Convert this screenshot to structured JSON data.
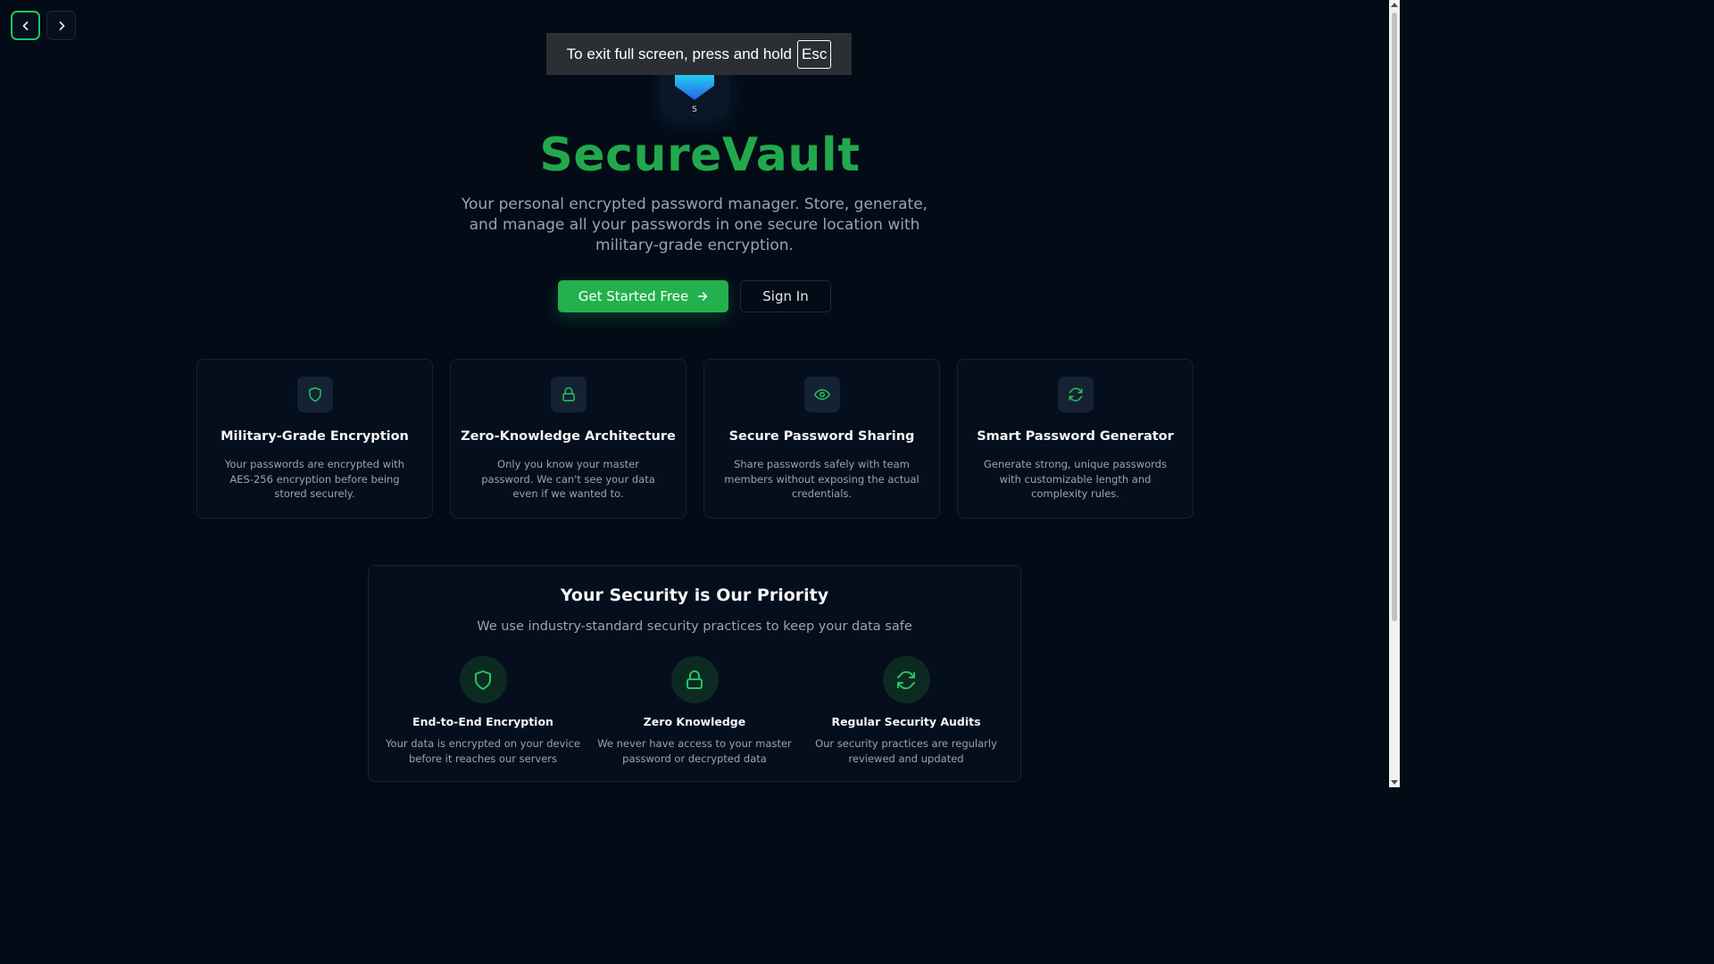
{
  "fullscreen_toast": {
    "message": "To exit full screen, press and hold",
    "key": "Esc"
  },
  "logo": {
    "letter": "S"
  },
  "hero": {
    "title": "SecureVault",
    "subtitle": "Your personal encrypted password manager. Store, generate, and manage all your passwords in one secure location with military-grade encryption.",
    "primary_cta": "Get Started Free",
    "secondary_cta": "Sign In"
  },
  "features": [
    {
      "icon": "shield-icon",
      "title": "Military-Grade Encryption",
      "description": "Your passwords are encrypted with AES-256 encryption before being stored securely."
    },
    {
      "icon": "lock-icon",
      "title": "Zero-Knowledge Architecture",
      "description": "Only you know your master password. We can't see your data even if we wanted to."
    },
    {
      "icon": "eye-icon",
      "title": "Secure Password Sharing",
      "description": "Share passwords safely with team members without exposing the actual credentials."
    },
    {
      "icon": "refresh-icon",
      "title": "Smart Password Generator",
      "description": "Generate strong, unique passwords with customizable length and complexity rules."
    }
  ],
  "security": {
    "title": "Your Security is Our Priority",
    "subtitle": "We use industry-standard security practices to keep your data safe",
    "items": [
      {
        "icon": "shield-icon",
        "title": "End-to-End Encryption",
        "description": "Your data is encrypted on your device before it reaches our servers"
      },
      {
        "icon": "lock-icon",
        "title": "Zero Knowledge",
        "description": "We never have access to your master password or decrypted data"
      },
      {
        "icon": "refresh-icon",
        "title": "Regular Security Audits",
        "description": "Our security practices are regularly reviewed and updated"
      }
    ]
  },
  "colors": {
    "accent": "#22b14c",
    "background": "#030b17",
    "title": "#22a84c"
  }
}
